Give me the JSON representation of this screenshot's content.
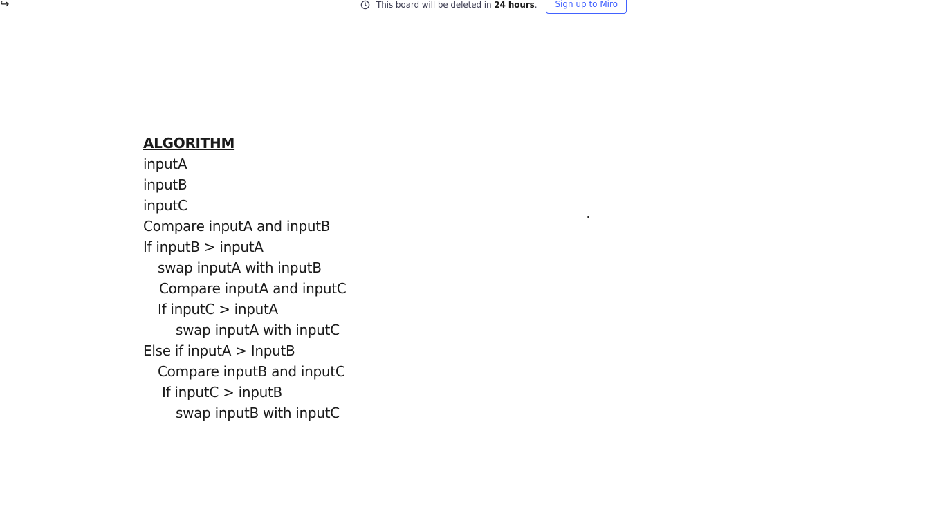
{
  "toolbar": {
    "redo_icon": "redo-icon"
  },
  "banner": {
    "icon": "clock-icon",
    "text_before": "This board will be deleted in ",
    "text_bold": "24 hours",
    "text_after": ".",
    "signup_label": "Sign up to Miro"
  },
  "colors": {
    "accent": "#4262ff",
    "text": "#1a1a1a",
    "banner_text": "#3d3d52"
  },
  "board": {
    "heading": "ALGORITHM",
    "lines": [
      {
        "indent": 0,
        "text": "inputA"
      },
      {
        "indent": 0,
        "text": "inputB"
      },
      {
        "indent": 0,
        "text": "inputC"
      },
      {
        "indent": 0,
        "text": "Compare inputA and inputB"
      },
      {
        "indent": 0,
        "text": "If inputB > inputA"
      },
      {
        "indent": 1,
        "text": "swap inputA with inputB"
      },
      {
        "indent": 1,
        "text": "Compare inputA and inputC"
      },
      {
        "indent": 1,
        "text": "If inputC > inputA"
      },
      {
        "indent": 2,
        "text": "swap inputA with inputC"
      },
      {
        "indent": 0,
        "text": "Else if inputA > InputB"
      },
      {
        "indent": 1,
        "text": "Compare inputB and inputC"
      },
      {
        "indent": 1,
        "text": "If inputC > inputB"
      },
      {
        "indent": 2,
        "text": "swap inputB with inputC"
      }
    ]
  }
}
